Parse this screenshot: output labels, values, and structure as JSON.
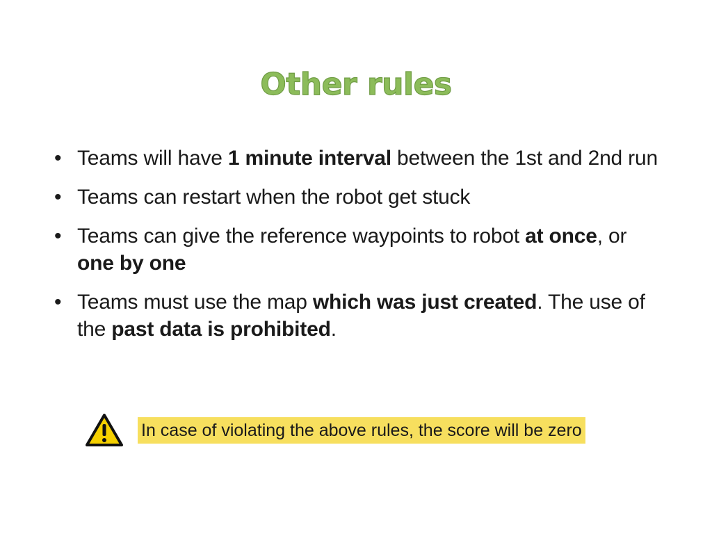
{
  "slide": {
    "title": "Other rules",
    "bullet_symbol": "•",
    "bullets": [
      {
        "parts": [
          {
            "text": "Teams will have ",
            "bold": false
          },
          {
            "text": "1 minute interval",
            "bold": true
          },
          {
            "text": " between the 1st and 2nd run",
            "bold": false
          }
        ]
      },
      {
        "parts": [
          {
            "text": "Teams can restart when the robot get stuck",
            "bold": false
          }
        ]
      },
      {
        "parts": [
          {
            "text": "Teams can give the reference waypoints to robot ",
            "bold": false
          },
          {
            "text": "at once",
            "bold": true
          },
          {
            "text": ", or ",
            "bold": false
          },
          {
            "text": "one by one",
            "bold": true
          }
        ]
      },
      {
        "parts": [
          {
            "text": "Teams must use the map ",
            "bold": false
          },
          {
            "text": "which was just created",
            "bold": true
          },
          {
            "text": ". The use of the ",
            "bold": false
          },
          {
            "text": "past data is prohibited",
            "bold": true
          },
          {
            "text": ".",
            "bold": false
          }
        ]
      }
    ],
    "warning": {
      "icon": "warning-triangle-icon",
      "text": "In case of violating the above rules, the score will be zero",
      "highlight_color": "#f7df5e",
      "icon_color": "#f5d000"
    },
    "colors": {
      "title": "#8cbc5a",
      "body_text": "#1a1a1a",
      "background": "#ffffff"
    }
  }
}
